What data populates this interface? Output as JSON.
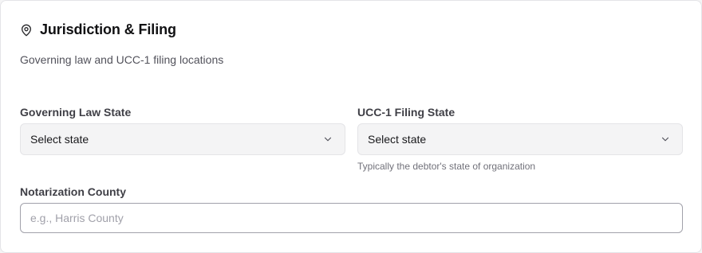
{
  "section": {
    "title": "Jurisdiction & Filing",
    "subtitle": "Governing law and UCC-1 filing locations",
    "icon": "map-pin-icon"
  },
  "fields": {
    "governing_law_state": {
      "label": "Governing Law State",
      "value": "Select state"
    },
    "ucc1_filing_state": {
      "label": "UCC-1 Filing State",
      "value": "Select state",
      "hint": "Typically the debtor's state of organization"
    },
    "notarization_county": {
      "label": "Notarization County",
      "value": "",
      "placeholder": "e.g., Harris County"
    }
  }
}
